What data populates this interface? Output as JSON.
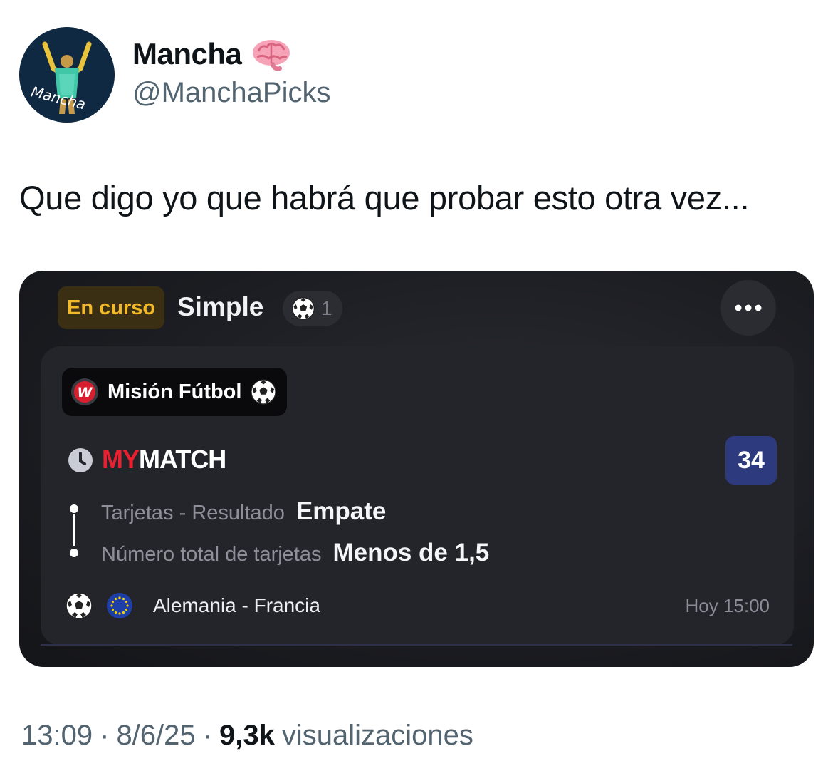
{
  "author": {
    "name": "Mancha",
    "handle": "@ManchaPicks",
    "avatar_text": "Mancha",
    "badge_icon": "brain-emoji-icon"
  },
  "tweet": {
    "text": "Que digo yo que habrá que probar esto otra vez..."
  },
  "bet_card": {
    "status": "En curso",
    "bet_type": "Simple",
    "selection_count": "1",
    "mission_label": "Misión Fútbol",
    "brand_red": "MY",
    "brand_white": "MATCH",
    "odds": "34",
    "selections": [
      {
        "market": "Tarjetas - Resultado",
        "pick": "Empate"
      },
      {
        "market": "Número total de tarjetas",
        "pick": "Menos de 1,5"
      }
    ],
    "event": {
      "teams": "Alemania - Francia",
      "time": "Hoy 15:00"
    },
    "colors": {
      "status_accent": "#f2b928",
      "brand_red": "#e8202f",
      "odds_bg": "#2d3a7d"
    }
  },
  "meta": {
    "time": "13:09",
    "separator": "·",
    "date": "8/6/25",
    "views_count": "9,3k",
    "views_label": "visualizaciones"
  }
}
